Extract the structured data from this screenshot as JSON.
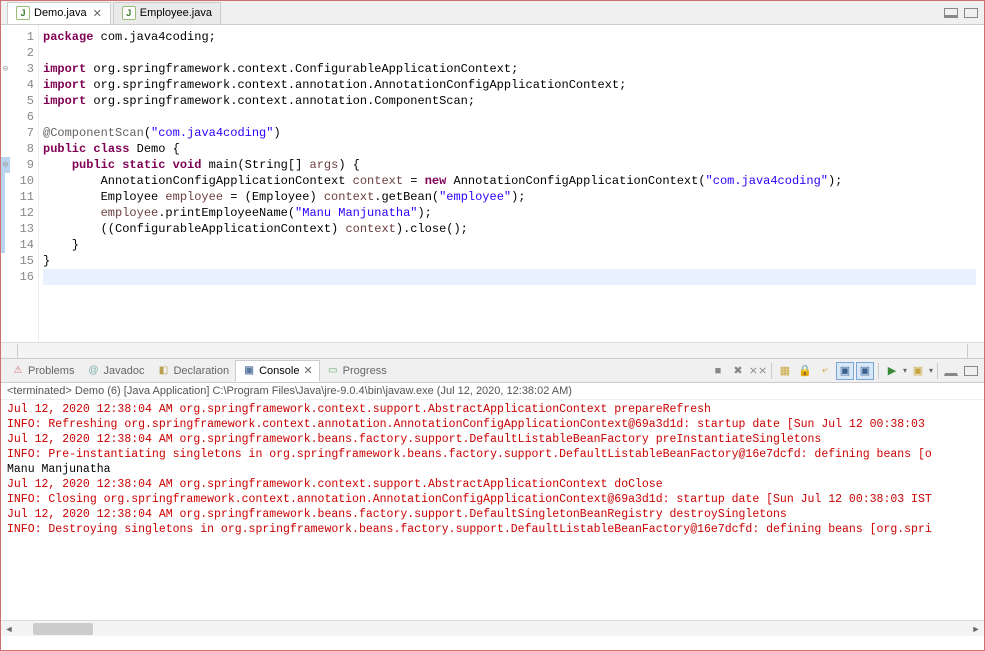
{
  "tabs": [
    {
      "label": "Demo.java",
      "active": true
    },
    {
      "label": "Employee.java",
      "active": false
    }
  ],
  "code": {
    "lines": [
      {
        "n": 1,
        "marker": "",
        "html": "<span class='kw'>package</span> com.java4coding;"
      },
      {
        "n": 2,
        "marker": "",
        "html": ""
      },
      {
        "n": 3,
        "marker": "fold-minus",
        "html": "<span class='kw'>import</span> org.springframework.context.ConfigurableApplicationContext;"
      },
      {
        "n": 4,
        "marker": "",
        "html": "<span class='kw'>import</span> org.springframework.context.annotation.AnnotationConfigApplicationContext;"
      },
      {
        "n": 5,
        "marker": "",
        "html": "<span class='kw'>import</span> org.springframework.context.annotation.ComponentScan;"
      },
      {
        "n": 6,
        "marker": "",
        "html": ""
      },
      {
        "n": 7,
        "marker": "",
        "html": "<span class='ann'>@ComponentScan</span>(<span class='str'>\"com.java4coding\"</span>)"
      },
      {
        "n": 8,
        "marker": "",
        "html": "<span class='kw'>public</span> <span class='kw'>class</span> Demo {"
      },
      {
        "n": 9,
        "marker": "fold-minus-change",
        "html": "    <span class='kw'>public</span> <span class='kw'>static</span> <span class='kw'>void</span> main(String[] <span class='var'>args</span>) {"
      },
      {
        "n": 10,
        "marker": "change",
        "html": "        AnnotationConfigApplicationContext <span class='var'>context</span> = <span class='kw'>new</span> AnnotationConfigApplicationContext(<span class='str'>\"com.java4coding\"</span>);"
      },
      {
        "n": 11,
        "marker": "change",
        "html": "        Employee <span class='var'>employee</span> = (Employee) <span class='var'>context</span>.getBean(<span class='str'>\"employee\"</span>);"
      },
      {
        "n": 12,
        "marker": "change",
        "html": "        <span class='var'>employee</span>.printEmployeeName(<span class='str'>\"Manu Manjunatha\"</span>);"
      },
      {
        "n": 13,
        "marker": "change",
        "html": "        ((ConfigurableApplicationContext) <span class='var'>context</span>).close();"
      },
      {
        "n": 14,
        "marker": "change",
        "html": "    }"
      },
      {
        "n": 15,
        "marker": "",
        "html": "}"
      },
      {
        "n": 16,
        "marker": "",
        "html": "",
        "highlighted": true
      }
    ]
  },
  "views": {
    "tabs": [
      "Problems",
      "Javadoc",
      "Declaration",
      "Console",
      "Progress"
    ],
    "active": "Console"
  },
  "terminated": "<terminated> Demo (6) [Java Application] C:\\Program Files\\Java\\jre-9.0.4\\bin\\javaw.exe (Jul 12, 2020, 12:38:02 AM)",
  "console": [
    {
      "cls": "red",
      "text": "Jul 12, 2020 12:38:04 AM org.springframework.context.support.AbstractApplicationContext prepareRefresh"
    },
    {
      "cls": "red",
      "text": "INFO: Refreshing org.springframework.context.annotation.AnnotationConfigApplicationContext@69a3d1d: startup date [Sun Jul 12 00:38:03 "
    },
    {
      "cls": "red",
      "text": "Jul 12, 2020 12:38:04 AM org.springframework.beans.factory.support.DefaultListableBeanFactory preInstantiateSingletons"
    },
    {
      "cls": "red",
      "text": "INFO: Pre-instantiating singletons in org.springframework.beans.factory.support.DefaultListableBeanFactory@16e7dcfd: defining beans [o"
    },
    {
      "cls": "blk",
      "text": "Manu Manjunatha"
    },
    {
      "cls": "red",
      "text": "Jul 12, 2020 12:38:04 AM org.springframework.context.support.AbstractApplicationContext doClose"
    },
    {
      "cls": "red",
      "text": "INFO: Closing org.springframework.context.annotation.AnnotationConfigApplicationContext@69a3d1d: startup date [Sun Jul 12 00:38:03 IST"
    },
    {
      "cls": "red",
      "text": "Jul 12, 2020 12:38:04 AM org.springframework.beans.factory.support.DefaultSingletonBeanRegistry destroySingletons"
    },
    {
      "cls": "red",
      "text": "INFO: Destroying singletons in org.springframework.beans.factory.support.DefaultListableBeanFactory@16e7dcfd: defining beans [org.spri"
    }
  ]
}
